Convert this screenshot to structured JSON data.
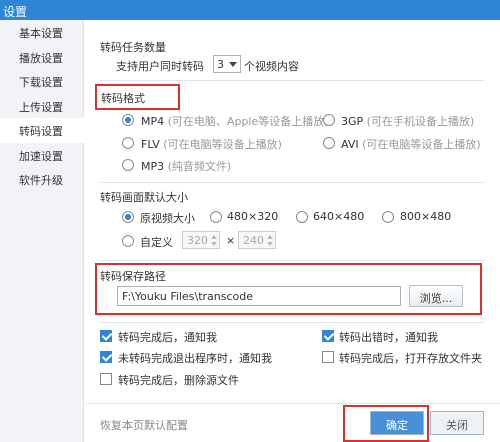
{
  "window": {
    "title": "设置"
  },
  "sidebar": {
    "items": [
      {
        "label": "基本设置"
      },
      {
        "label": "播放设置"
      },
      {
        "label": "下载设置"
      },
      {
        "label": "上传设置"
      },
      {
        "label": "转码设置",
        "active": true
      },
      {
        "label": "加速设置"
      },
      {
        "label": "软件升级"
      }
    ]
  },
  "task_count": {
    "title": "转码任务数量",
    "prefix": "支持用户同时转码",
    "value": "3",
    "suffix": "个视频内容"
  },
  "format": {
    "title": "转码格式",
    "options": [
      {
        "name": "MP4",
        "note": "(可在电脑、Apple等设备上播放)",
        "checked": true
      },
      {
        "name": "3GP",
        "note": "(可在手机设备上播放)",
        "checked": false
      },
      {
        "name": "FLV",
        "note": "(可在电脑等设备上播放)",
        "checked": false
      },
      {
        "name": "AVI",
        "note": "(可在电脑等设备上播放)",
        "checked": false
      },
      {
        "name": "MP3",
        "note": "(纯音频文件)",
        "checked": false
      }
    ]
  },
  "size": {
    "title": "转码画面默认大小",
    "options": [
      {
        "label": "原视频大小",
        "checked": true
      },
      {
        "label": "480×320",
        "checked": false
      },
      {
        "label": "640×480",
        "checked": false
      },
      {
        "label": "800×480",
        "checked": false
      }
    ],
    "custom": {
      "label": "自定义",
      "width": "320",
      "times": "×",
      "height": "240"
    }
  },
  "save_path": {
    "title": "转码保存路径",
    "value": "F:\\Youku Files\\transcode",
    "browse_label": "浏览..."
  },
  "notify": {
    "items": [
      {
        "label": "转码完成后，通知我",
        "checked": true
      },
      {
        "label": "转码出错时，通知我",
        "checked": true
      },
      {
        "label": "未转码完成退出程序时，通知我",
        "checked": true
      },
      {
        "label": "转码完成后，打开存放文件夹",
        "checked": false
      },
      {
        "label": "转码完成后，删除源文件",
        "checked": false
      }
    ]
  },
  "footer": {
    "restore_label": "恢复本页默认配置",
    "confirm_label": "确定",
    "close_label": "关闭"
  },
  "colors": {
    "titlebar": "#2f86d6",
    "highlight_box": "#d9322e",
    "accent": "#2f86d6"
  }
}
